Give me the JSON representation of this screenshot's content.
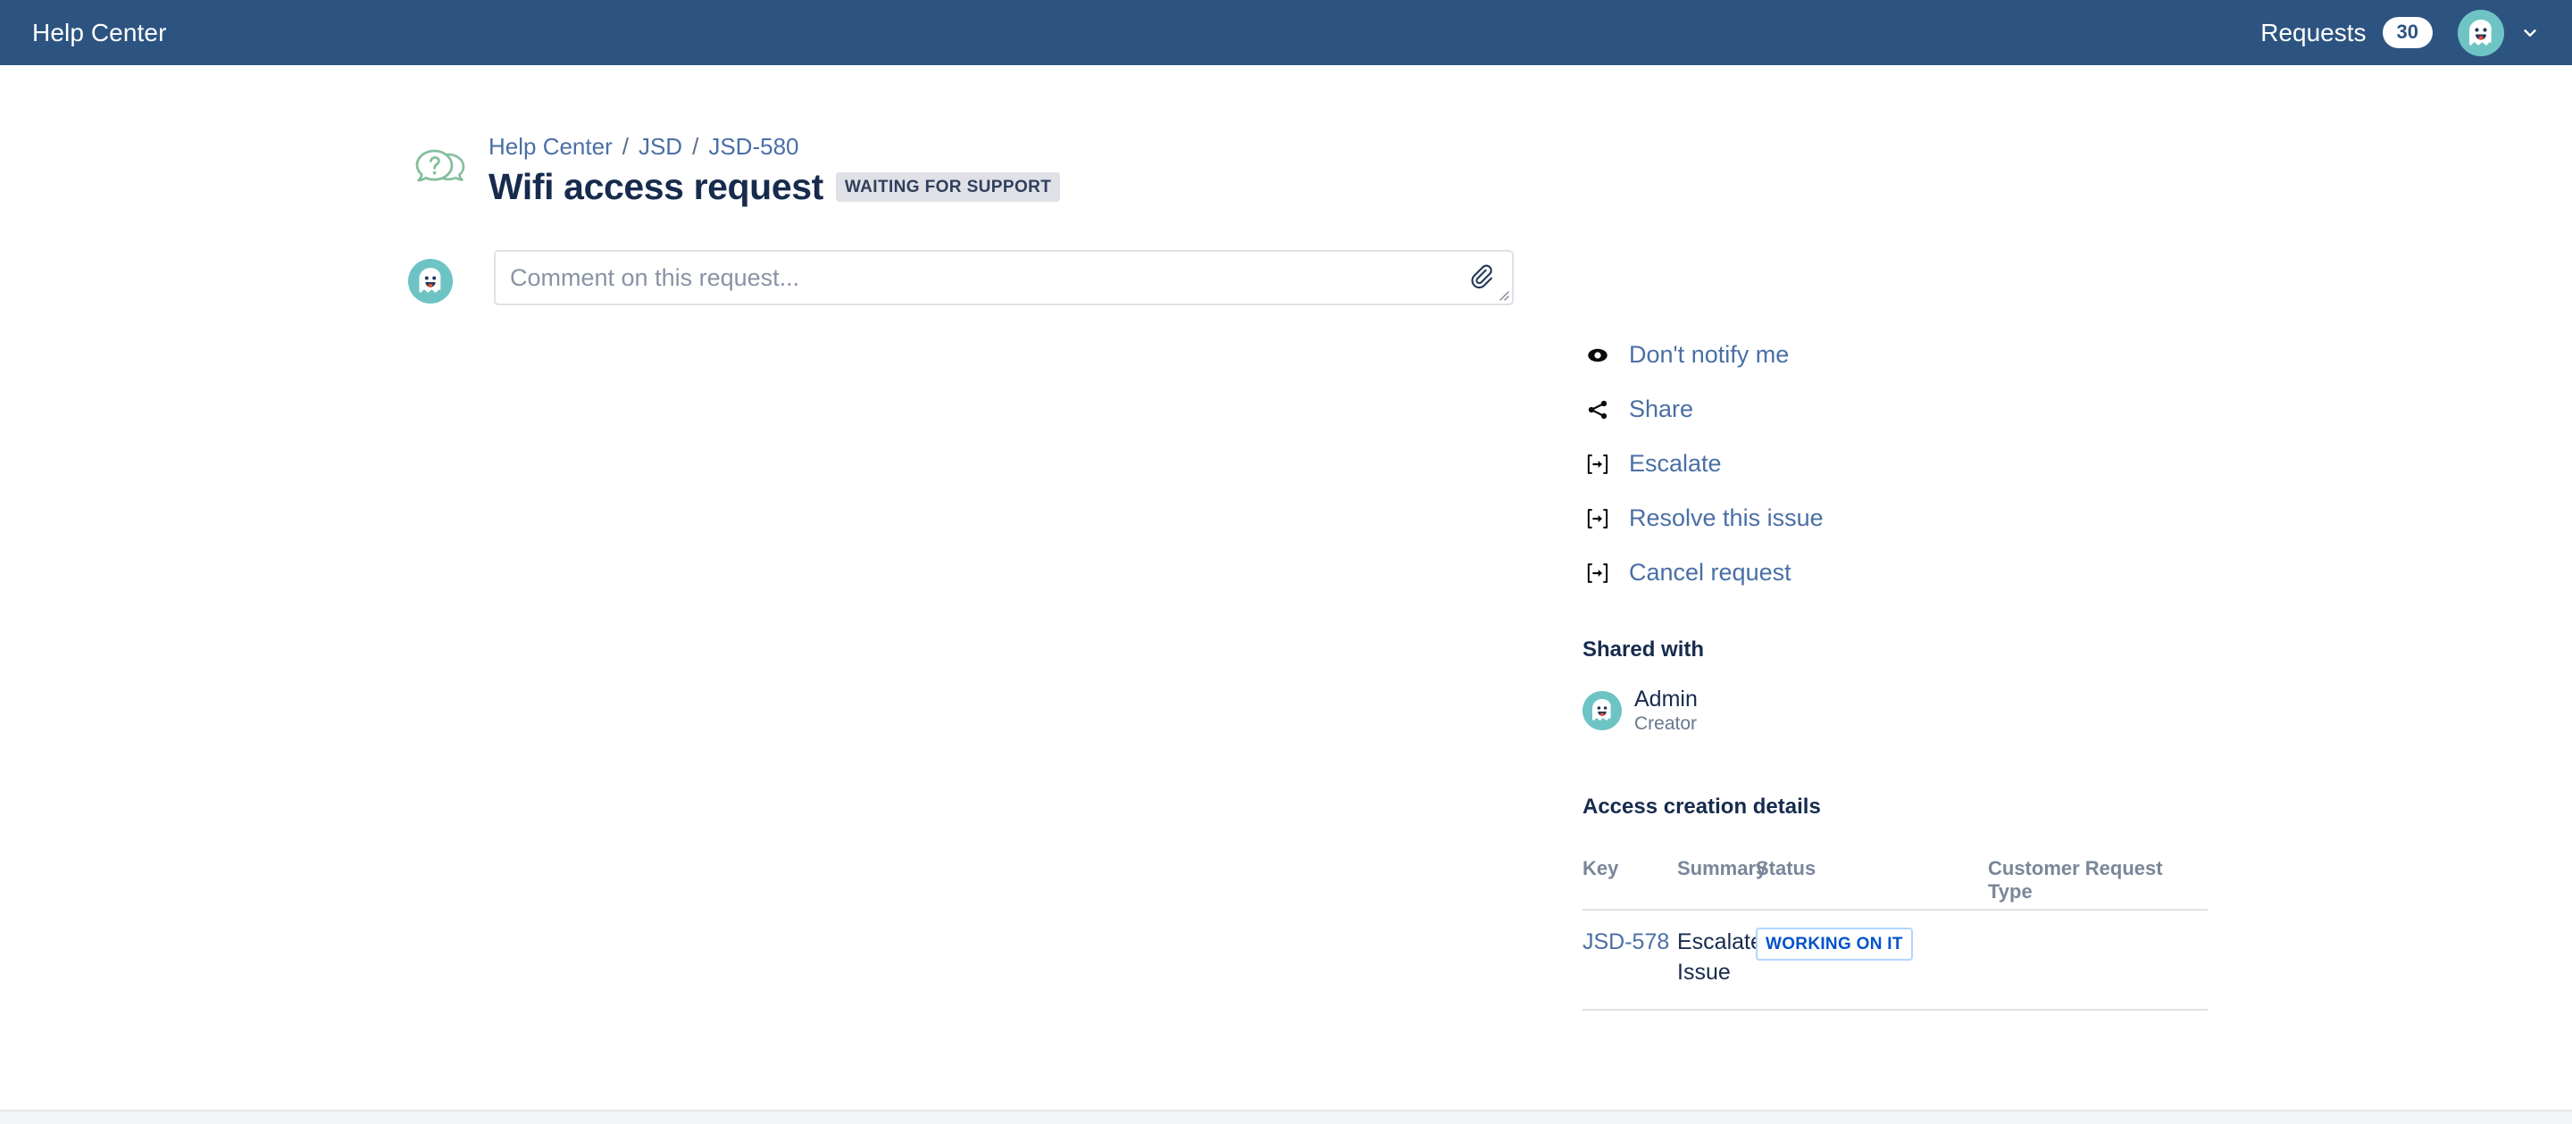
{
  "header": {
    "title": "Help Center",
    "requests_label": "Requests",
    "requests_count": "30",
    "avatar_icon": "ghost-avatar",
    "chevron_icon": "chevron-down-icon",
    "background_color": "#2d5480"
  },
  "breadcrumb": {
    "items": [
      {
        "label": "Help Center"
      },
      {
        "label": "JSD"
      },
      {
        "label": "JSD-580"
      }
    ],
    "separator": "/"
  },
  "request": {
    "project_icon": "speech-bubbles-question-icon",
    "title": "Wifi access request",
    "status": "WAITING FOR SUPPORT",
    "status_bg": "#dfe1e6",
    "status_color": "#2f3e5c"
  },
  "comment": {
    "avatar_icon": "ghost-avatar",
    "placeholder": "Comment on this request...",
    "value": "",
    "attach_icon": "paperclip-icon",
    "resize_icon": "resize-handle-icon"
  },
  "actions": [
    {
      "label": "Don't notify me",
      "icon": "eye-icon"
    },
    {
      "label": "Share",
      "icon": "share-icon"
    },
    {
      "label": "Escalate",
      "icon": "workflow-transition-icon"
    },
    {
      "label": "Resolve this issue",
      "icon": "workflow-transition-icon"
    },
    {
      "label": "Cancel request",
      "icon": "workflow-transition-icon"
    }
  ],
  "shared_with": {
    "heading": "Shared with",
    "people": [
      {
        "name": "Admin",
        "role": "Creator",
        "avatar_icon": "ghost-avatar"
      }
    ]
  },
  "details": {
    "heading": "Access creation details",
    "columns": [
      "Key",
      "Summary",
      "Status",
      "Customer Request Type"
    ],
    "rows": [
      {
        "key": "JSD-578",
        "summary": "Escalate Issue",
        "status": "WORKING ON IT",
        "status_color": "#0052cc",
        "status_border": "#b3d4ff",
        "customer_request_type": ""
      }
    ]
  },
  "link_color": "#4a6fa5"
}
